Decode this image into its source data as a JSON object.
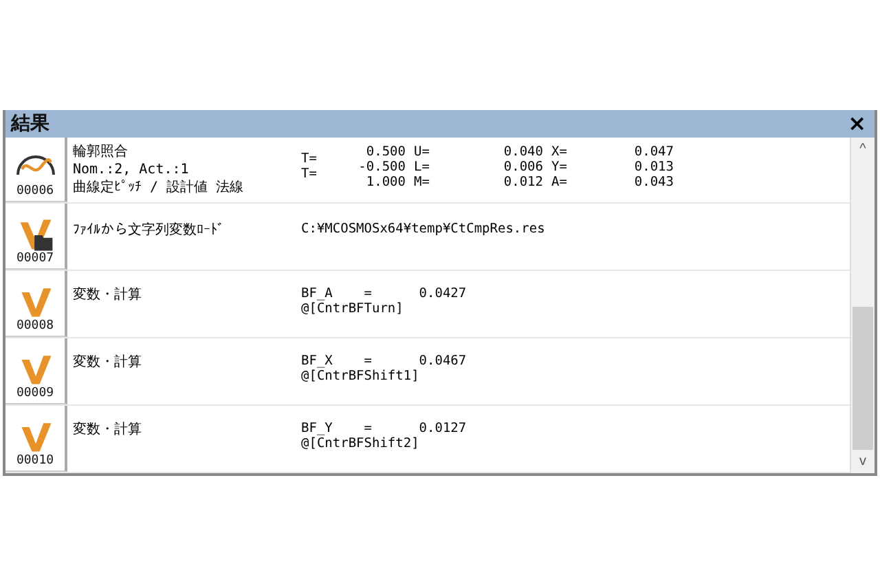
{
  "panel": {
    "title": "結果",
    "close": "×"
  },
  "rows": [
    {
      "kind": "curve",
      "number": "00006",
      "description": [
        "輪郭照合",
        "Nom.:2, Act.:1",
        "曲線定ﾋﾟｯﾁ / 設計値 法線"
      ],
      "labels": [
        "T=",
        "T="
      ],
      "cells": [
        [
          "0.500",
          "U=",
          "0.040",
          "X=",
          "0.047"
        ],
        [
          "-0.500",
          "L=",
          "0.006",
          "Y=",
          "0.013"
        ],
        [
          "1.000",
          "M=",
          "0.012",
          "A=",
          "0.043"
        ]
      ]
    },
    {
      "kind": "file-load",
      "number": "00007",
      "description": [
        "ﾌｧｲﾙから文字列変数ﾛｰﾄﾞ"
      ],
      "lines": [
        "C:¥MCOSMOSx64¥temp¥CtCmpRes.res"
      ]
    },
    {
      "kind": "calc",
      "number": "00008",
      "description": [
        "変数・計算"
      ],
      "lines": [
        "BF_A    =      0.0427",
        "@[CntrBFTurn]"
      ]
    },
    {
      "kind": "calc",
      "number": "00009",
      "description": [
        "変数・計算"
      ],
      "lines": [
        "BF_X    =      0.0467",
        "@[CntrBFShift1]"
      ]
    },
    {
      "kind": "calc",
      "number": "00010",
      "description": [
        "変数・計算"
      ],
      "lines": [
        "BF_Y    =      0.0127",
        "@[CntrBFShift2]"
      ]
    }
  ],
  "scrollbar": {
    "up": "^",
    "down": "v"
  }
}
